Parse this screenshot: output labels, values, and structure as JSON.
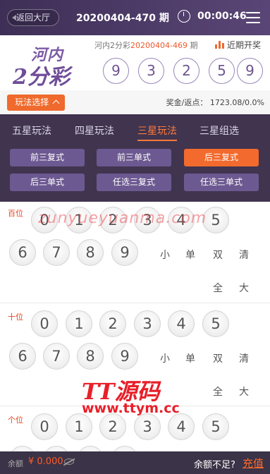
{
  "header": {
    "back_label": "返回大厅",
    "issue_title": "20200404-470 期",
    "countdown": "00:00:46"
  },
  "game": {
    "logo_top": "河内",
    "logo_bottom": "2分彩",
    "prev_prefix": "河内2分彩",
    "prev_issue": "20200404-469",
    "prev_suffix": " 期",
    "trend_label": "近期开奖",
    "result_balls": [
      "9",
      "3",
      "2",
      "5",
      "9"
    ]
  },
  "play": {
    "select_label": "玩法选择",
    "bonus": "奖金/返点：  1723.08/0.0%"
  },
  "tabs": [
    {
      "label": "五星玩法",
      "active": false
    },
    {
      "label": "四星玩法",
      "active": false
    },
    {
      "label": "三星玩法",
      "active": true
    },
    {
      "label": "三星组选",
      "active": false
    }
  ],
  "subtypes": [
    {
      "label": "前三复式",
      "active": false
    },
    {
      "label": "前三单式",
      "active": false
    },
    {
      "label": "后三复式",
      "active": true
    },
    {
      "label": "后三单式",
      "active": false
    },
    {
      "label": "任选三复式",
      "active": false
    },
    {
      "label": "任选三单式",
      "active": false
    }
  ],
  "positions": [
    {
      "label": "百位"
    },
    {
      "label": "十位"
    },
    {
      "label": "个位"
    }
  ],
  "digits": [
    "0",
    "1",
    "2",
    "3",
    "4",
    "5",
    "6",
    "7",
    "8",
    "9"
  ],
  "quick": [
    "小",
    "单",
    "双",
    "清",
    "全",
    "大"
  ],
  "watermarks": {
    "line1": "zunyueyuanma.com",
    "line2": "TT源码",
    "line3": "www.ttym.cc"
  },
  "footer": {
    "balance_label": "余额",
    "balance": "¥ 0.000",
    "low_balance": "余额不足?",
    "recharge": "充值"
  },
  "colors": {
    "accent": "#ef6a2c",
    "panel": "#40344f",
    "purple_button": "#6d5991"
  }
}
